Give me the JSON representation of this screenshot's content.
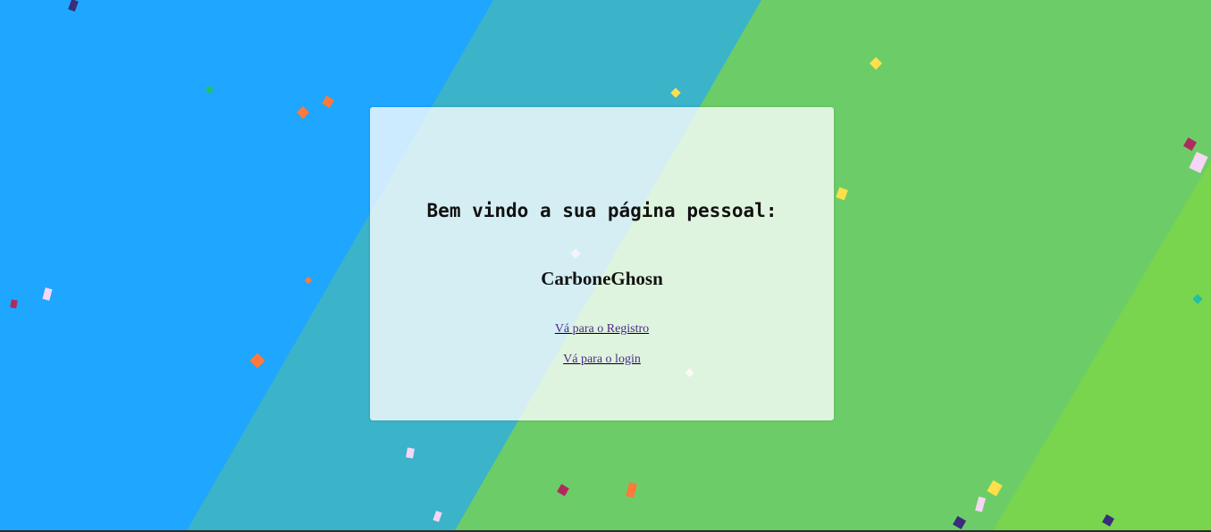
{
  "page": {
    "heading": "Bem vindo a sua página pessoal:",
    "username": "CarboneGhosn",
    "links": {
      "register": "Vá para o Registro",
      "login": "Vá para o login"
    }
  },
  "colors": {
    "blue": "#1fa6ff",
    "teal": "#3bb3c9",
    "green": "#6ccd68",
    "light_green": "#79d44e",
    "link": "#4b2a8a"
  }
}
